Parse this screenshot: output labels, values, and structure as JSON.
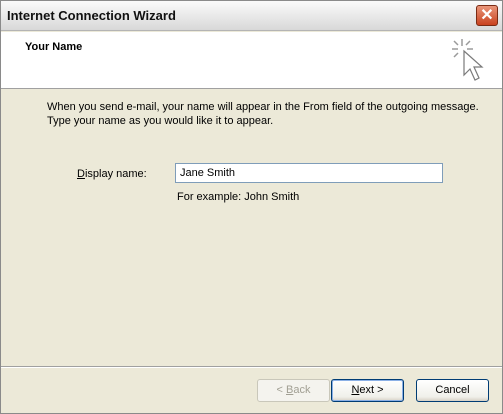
{
  "window": {
    "title": "Internet Connection Wizard",
    "close_label": "✕"
  },
  "header": {
    "title": "Your Name"
  },
  "content": {
    "intro_line1": "When you send e-mail, your name will appear in the From field of the outgoing message.",
    "intro_line2": "Type your name as you would like it to appear.",
    "display_name_label_accel": "D",
    "display_name_label_rest": "isplay name:",
    "display_name_value": "Jane Smith",
    "example": "For example: John Smith"
  },
  "buttons": {
    "back_prefix": "< ",
    "back_accel": "B",
    "back_rest": "ack",
    "next_accel": "N",
    "next_rest": "ext >",
    "cancel": "Cancel"
  },
  "colors": {
    "dialog_bg": "#ece9d8",
    "close_button": "#c9421f",
    "input_border": "#7f9db9"
  }
}
